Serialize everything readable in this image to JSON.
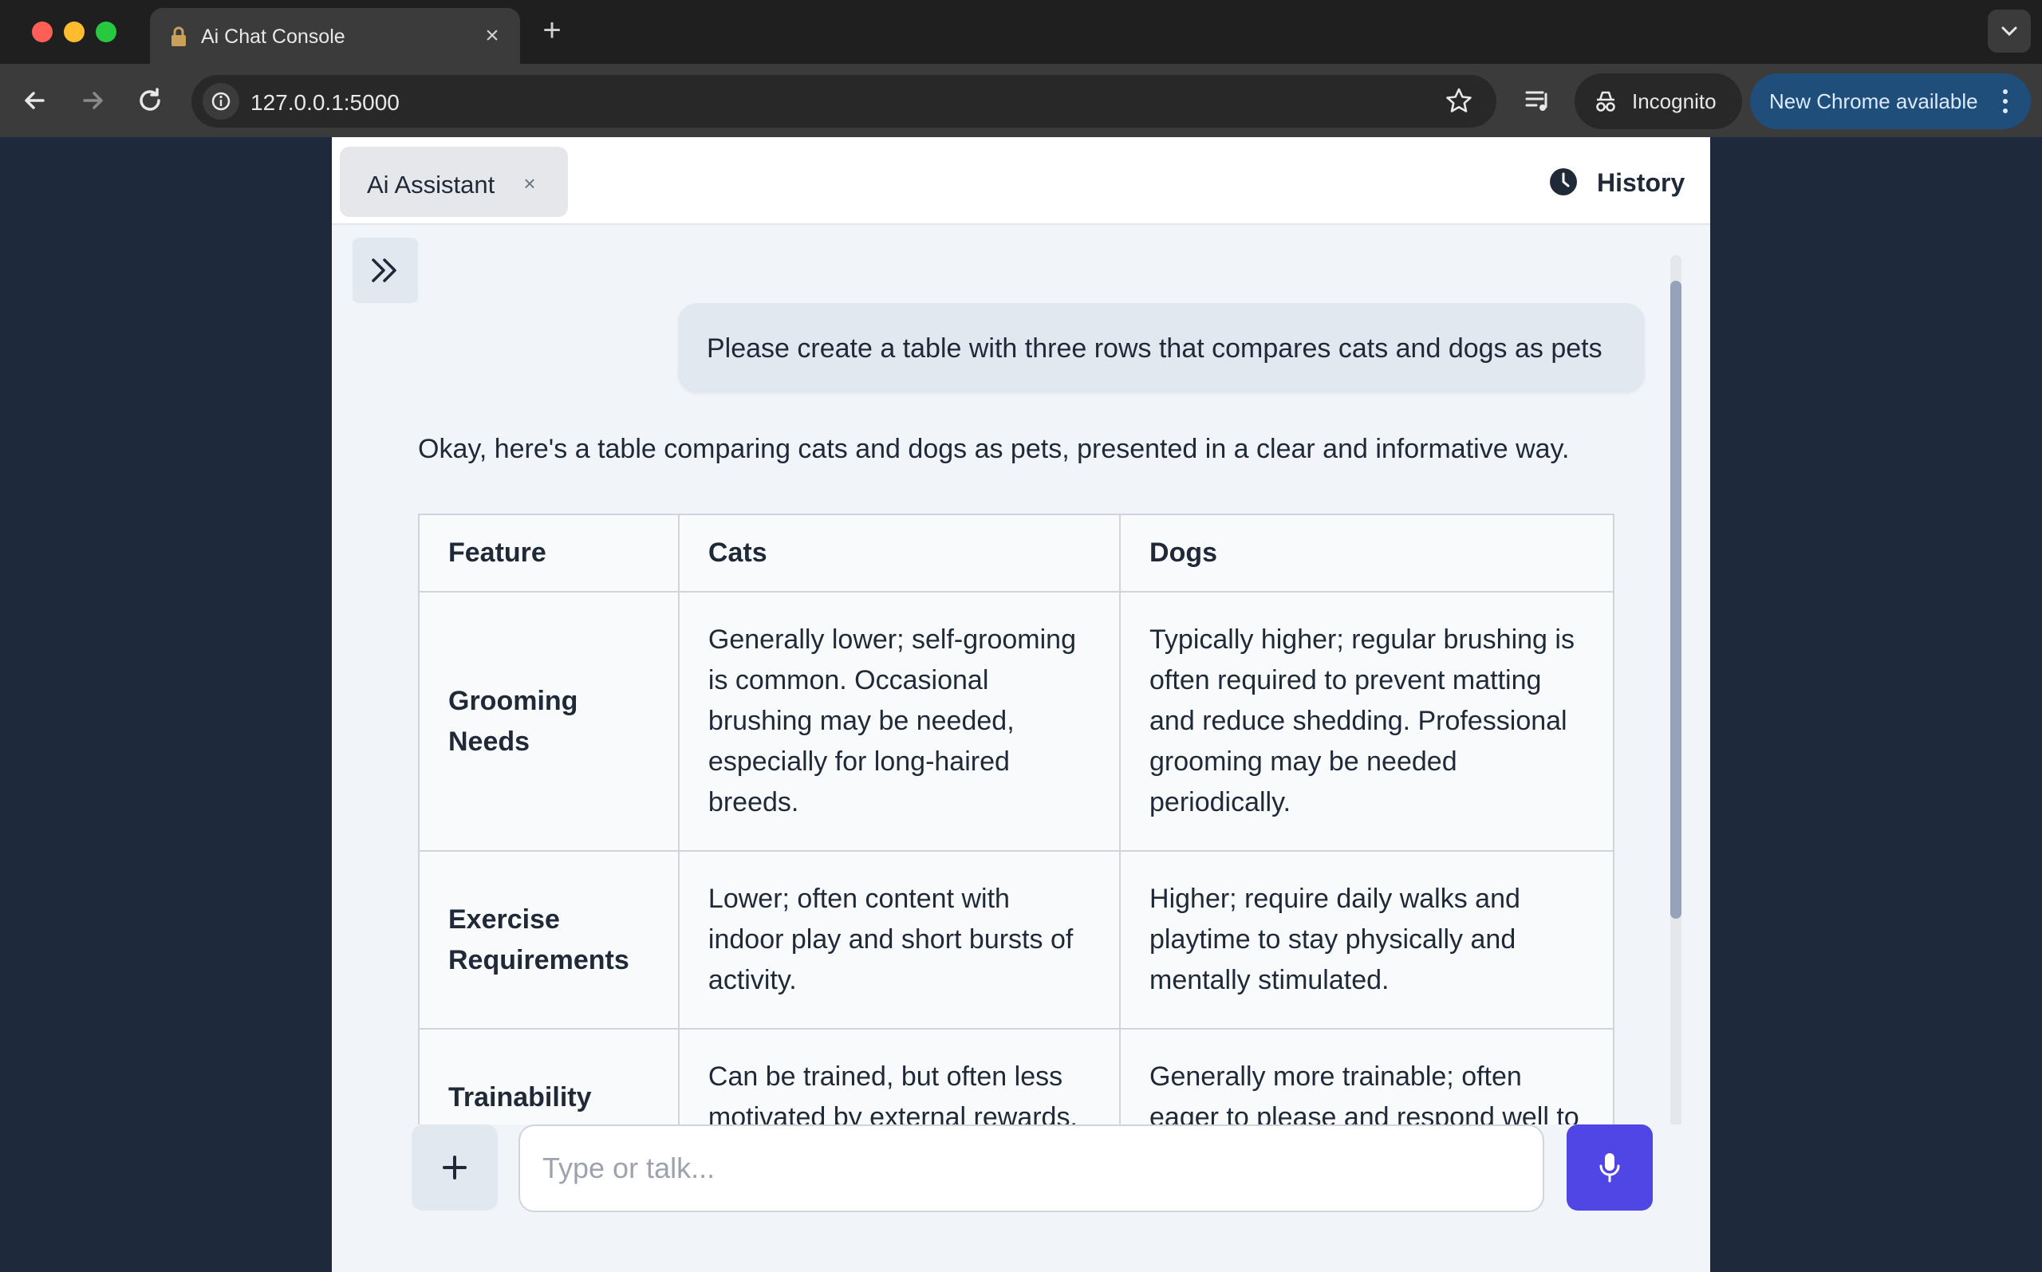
{
  "browser": {
    "tab_title": "Ai Chat Console",
    "tab_close": "×",
    "new_tab": "+",
    "url": "127.0.0.1:5000",
    "incognito_label": "Incognito",
    "update_label": "New Chrome available"
  },
  "header": {
    "assistant_tab_label": "Ai Assistant",
    "assistant_tab_close": "×",
    "history_label": "History"
  },
  "conversation": {
    "user_message": "Please create a table with three rows that compares cats and dogs as pets",
    "assistant_intro": "Okay, here's a table comparing cats and dogs as pets, presented in a clear and informative way.",
    "table": {
      "headers": [
        "Feature",
        "Cats",
        "Dogs"
      ],
      "rows": [
        [
          "Grooming Needs",
          "Generally lower; self-grooming is common. Occasional brushing may be needed, especially for long-haired breeds.",
          "Typically higher; regular brushing is often required to prevent matting and reduce shedding. Professional grooming may be needed periodically."
        ],
        [
          "Exercise Requirements",
          "Lower; often content with indoor play and short bursts of activity.",
          "Higher; require daily walks and playtime to stay physically and mentally stimulated."
        ],
        [
          "Trainability",
          "Can be trained, but often less motivated by external rewards.",
          "Generally more trainable; often eager to please and respond well to"
        ]
      ]
    }
  },
  "composer": {
    "placeholder": "Type or talk..."
  },
  "colors": {
    "accent": "#4f46e5",
    "page_bg": "#1e293b",
    "app_bg": "#f1f5f9"
  }
}
